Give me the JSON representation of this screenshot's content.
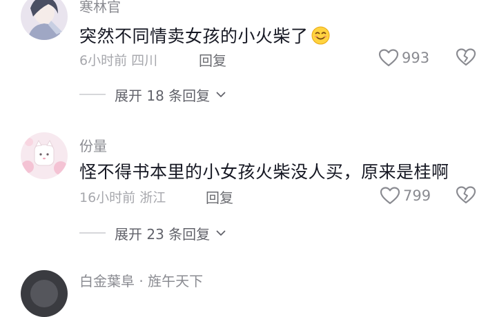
{
  "comments": [
    {
      "username": "寒林官",
      "text": "突然不同情卖女孩的小火柴了",
      "emoji": "smiling-face-icon",
      "time": "6小时前",
      "location": "四川",
      "reply_label": "回复",
      "likes": "993",
      "expand_label": "展开 18 条回复"
    },
    {
      "username": "份量",
      "text": "怪不得书本里的小女孩火柴没人买，原来是桂啊",
      "time": "16小时前",
      "location": "浙江",
      "reply_label": "回复",
      "likes": "799",
      "expand_label": "展开 23 条回复"
    },
    {
      "username": "白金葉阜 · 旌午天下"
    }
  ],
  "colors": {
    "text_primary": "#161823",
    "text_secondary": "#8a8b91",
    "divider": "#d6d7da"
  }
}
